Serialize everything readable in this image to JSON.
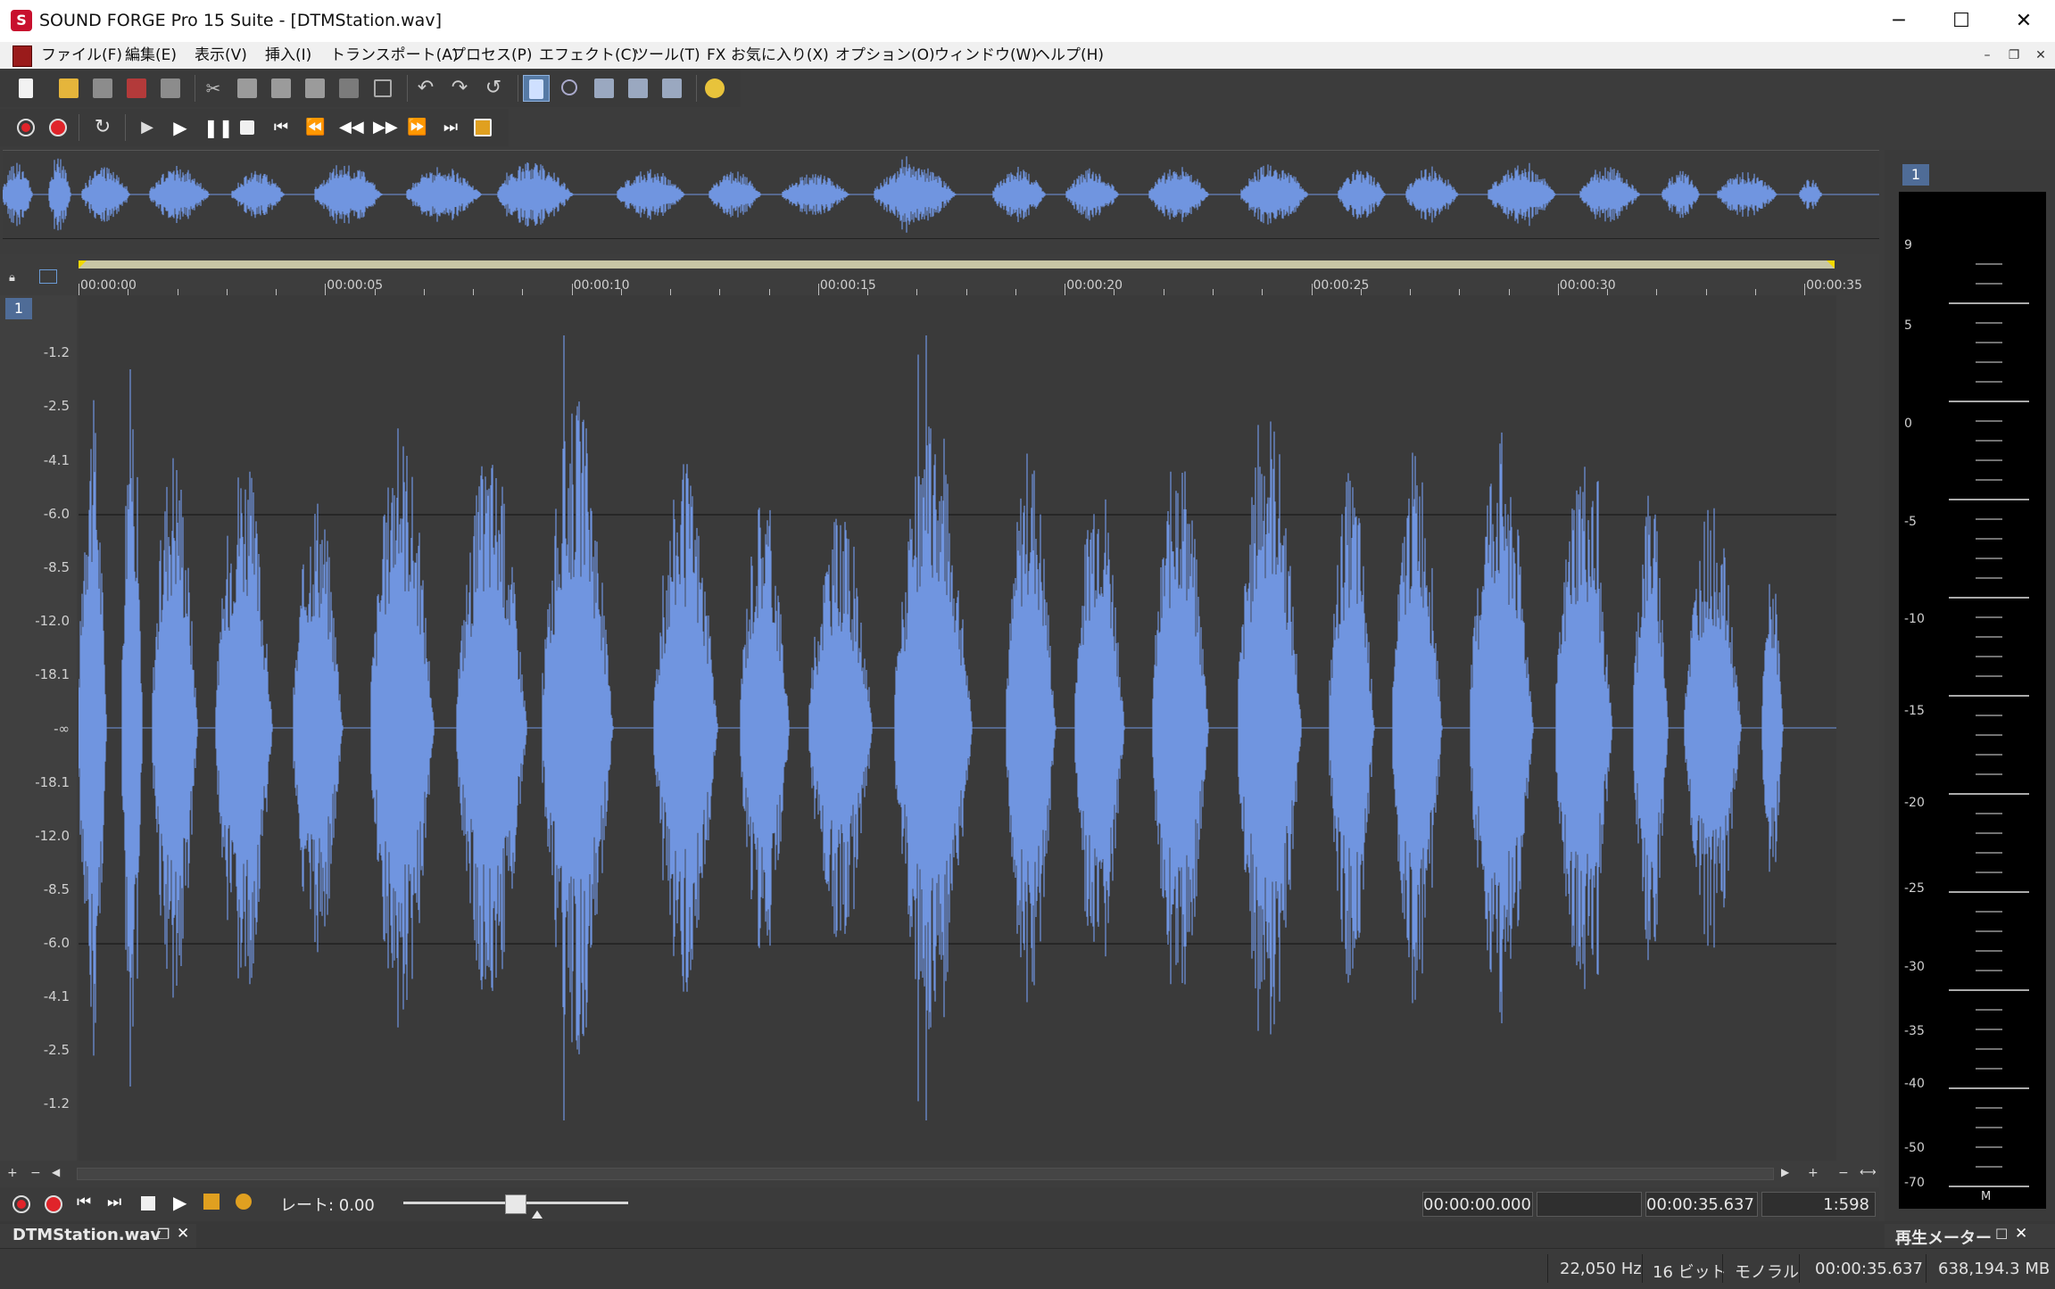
{
  "window": {
    "title": "SOUND FORGE Pro 15 Suite - [DTMStation.wav]",
    "app_icon_glyph": "S",
    "minimize_glyph": "─",
    "maximize_glyph": "☐",
    "close_glyph": "✕"
  },
  "menu": {
    "items": [
      "ファイル(F)",
      "編集(E)",
      "表示(V)",
      "挿入(I)",
      "トランスポート(A)",
      "プロセス(P)",
      "エフェクト(C)",
      "ツール(T)",
      "FX お気に入り(X)",
      "オプション(O)",
      "ウィンドウ(W)",
      "ヘルプ(H)"
    ],
    "mdi_minimize": "–",
    "mdi_restore": "❐",
    "mdi_close": "✕"
  },
  "track": {
    "number": "1"
  },
  "ruler": {
    "labels": [
      "00:00:00",
      "00:00:05",
      "00:00:10",
      "00:00:15",
      "00:00:20",
      "00:00:25",
      "00:00:30",
      "00:00:35"
    ]
  },
  "db_scale": {
    "labels": [
      "-1.2",
      "-2.5",
      "-4.1",
      "-6.0",
      "-8.5",
      "-12.0",
      "-18.1",
      "-∞",
      "-18.1",
      "-12.0",
      "-8.5",
      "-6.0",
      "-4.1",
      "-2.5",
      "-1.2"
    ]
  },
  "transport_bottom": {
    "rate_label": "レート: 0.00",
    "selection_start": "00:00:00.000",
    "selection_end": "",
    "length": "00:00:35.637",
    "zoom": "1:598"
  },
  "doc_tab": {
    "name": "DTMStation.wav",
    "restore_glyph": "❐",
    "close_glyph": "✕"
  },
  "meter": {
    "title": "再生メーター",
    "channel": "1",
    "scale": [
      "9",
      "5",
      "0",
      "-5",
      "-10",
      "-15",
      "-20",
      "-25",
      "-30",
      "-35",
      "-40",
      "-50",
      "-70"
    ],
    "channel_label": "M",
    "restore_glyph": "☐",
    "close_glyph": "✕"
  },
  "status": {
    "sample_rate": "22,050 Hz",
    "bit_depth": "16 ビット",
    "channels": "モノラル",
    "duration": "00:00:35.637",
    "disk_space": "638,194.3 MB"
  },
  "colors": {
    "waveform": "#7095e0",
    "background": "#3a3a3a",
    "selection": "#c8c6a6",
    "accent": "#4f6c97"
  }
}
